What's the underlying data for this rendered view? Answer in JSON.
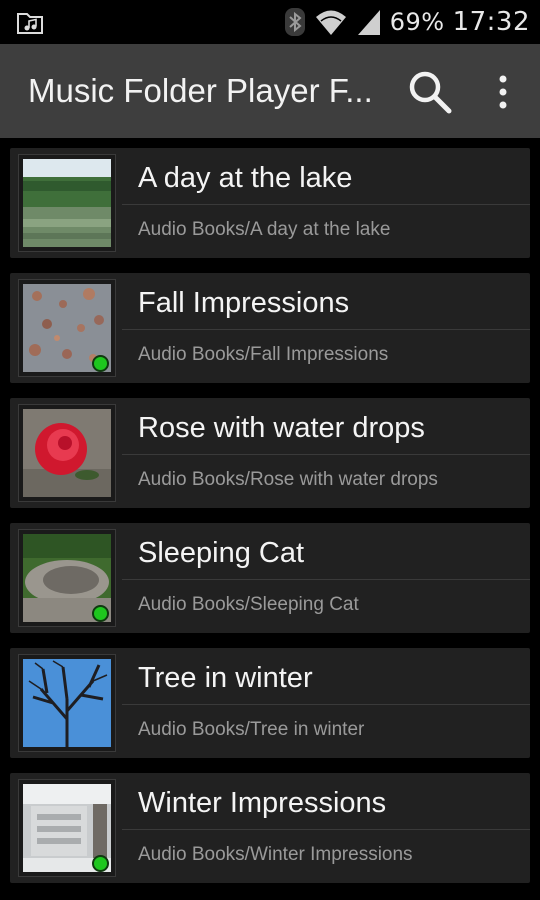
{
  "status_bar": {
    "battery": "69%",
    "time": "17:32",
    "icons": [
      "music-folder-icon",
      "bluetooth-icon",
      "wifi-icon",
      "signal-icon"
    ]
  },
  "action_bar": {
    "title": "Music Folder Player F...",
    "search_icon": "search-icon",
    "menu_icon": "overflow-menu-icon"
  },
  "colors": {
    "action_bar_bg": "#3e3e3e",
    "item_bg": "#212121",
    "playing_dot": "#1ec71e"
  },
  "folders": [
    {
      "title": "A day at the lake",
      "path": "Audio Books/A day at the lake",
      "thumb": "lake",
      "playing": false
    },
    {
      "title": "Fall Impressions",
      "path": "Audio Books/Fall Impressions",
      "thumb": "leaves",
      "playing": true
    },
    {
      "title": "Rose with water drops",
      "path": "Audio Books/Rose with water drops",
      "thumb": "rose",
      "playing": false
    },
    {
      "title": "Sleeping Cat",
      "path": "Audio Books/Sleeping Cat",
      "thumb": "cat",
      "playing": true
    },
    {
      "title": "Tree in winter",
      "path": "Audio Books/Tree in winter",
      "thumb": "tree",
      "playing": false
    },
    {
      "title": "Winter Impressions",
      "path": "Audio Books/Winter Impressions",
      "thumb": "snow",
      "playing": true
    }
  ]
}
